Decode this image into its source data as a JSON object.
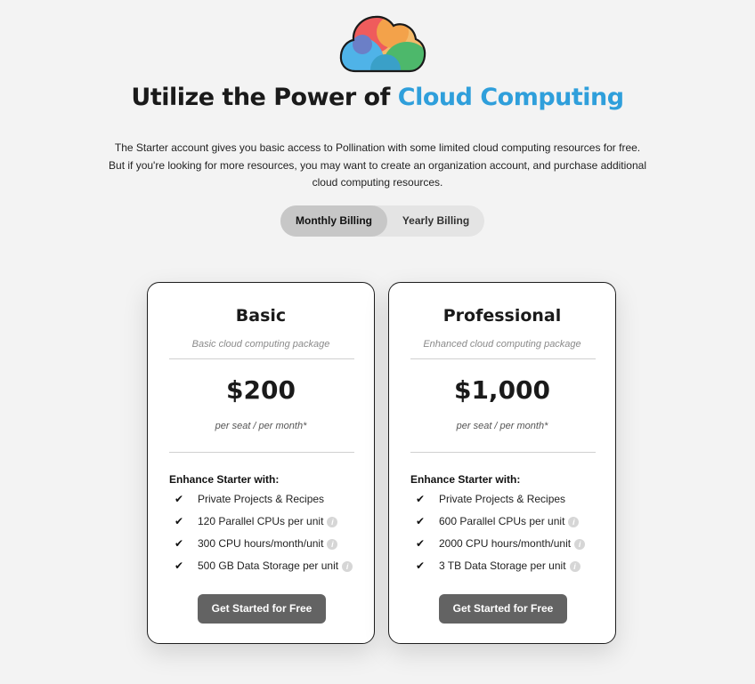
{
  "hero": {
    "title_prefix": "Utilize the Power of",
    "title_accent": "Cloud Computing",
    "intro": "The Starter account gives you basic access to Pollination with some limited cloud computing resources for free. But if you're looking for more resources, you may want to create an organization account, and purchase additional cloud computing resources."
  },
  "billing_toggle": {
    "options": [
      "Monthly Billing",
      "Yearly Billing"
    ],
    "selected": "Monthly Billing"
  },
  "plans": [
    {
      "name": "Basic",
      "subtitle": "Basic cloud computing package",
      "price": "$200",
      "period": "per seat / per month*",
      "enhance_label": "Enhance Starter with:",
      "features": [
        {
          "text": "Private Projects & Recipes",
          "info": false
        },
        {
          "text": "120 Parallel CPUs per unit",
          "info": true
        },
        {
          "text": "300 CPU hours/month/unit",
          "info": true
        },
        {
          "text": "500 GB Data Storage per unit",
          "info": true
        }
      ],
      "cta": "Get Started for Free"
    },
    {
      "name": "Professional",
      "subtitle": "Enhanced cloud computing package",
      "price": "$1,000",
      "period": "per seat / per month*",
      "enhance_label": "Enhance Starter with:",
      "features": [
        {
          "text": "Private Projects & Recipes",
          "info": false
        },
        {
          "text": "600 Parallel CPUs per unit",
          "info": true
        },
        {
          "text": "2000 CPU hours/month/unit",
          "info": true
        },
        {
          "text": "3 TB Data Storage per unit",
          "info": true
        }
      ],
      "cta": "Get Started for Free"
    }
  ],
  "icons": {
    "logo": "cloud-logo-icon",
    "check": "check-icon",
    "info": "info-icon"
  },
  "colors": {
    "accent": "#2f9fdb",
    "cta_bg": "#636363",
    "toggle_selected": "#c7c7c7",
    "toggle_bg": "#e4e4e4",
    "page_bg": "#f3f3f3"
  }
}
